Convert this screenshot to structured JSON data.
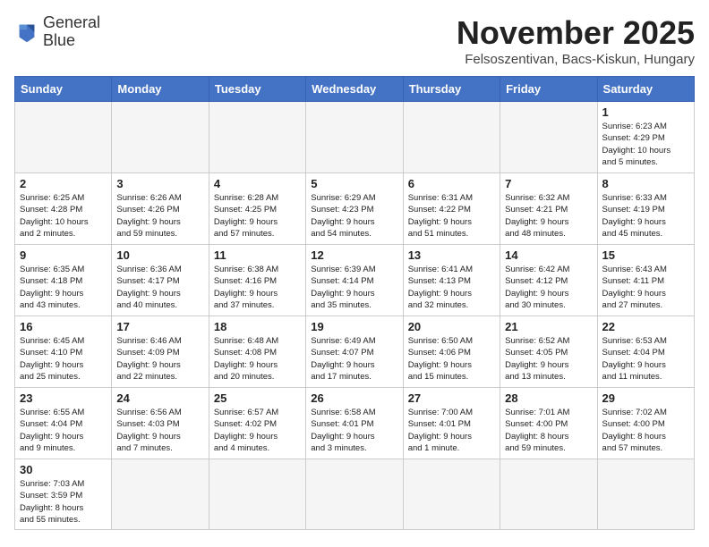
{
  "header": {
    "logo_line1": "General",
    "logo_line2": "Blue",
    "month_title": "November 2025",
    "location": "Felsoszentivan, Bacs-Kiskun, Hungary"
  },
  "weekdays": [
    "Sunday",
    "Monday",
    "Tuesday",
    "Wednesday",
    "Thursday",
    "Friday",
    "Saturday"
  ],
  "weeks": [
    [
      {
        "day": "",
        "info": ""
      },
      {
        "day": "",
        "info": ""
      },
      {
        "day": "",
        "info": ""
      },
      {
        "day": "",
        "info": ""
      },
      {
        "day": "",
        "info": ""
      },
      {
        "day": "",
        "info": ""
      },
      {
        "day": "1",
        "info": "Sunrise: 6:23 AM\nSunset: 4:29 PM\nDaylight: 10 hours\nand 5 minutes."
      }
    ],
    [
      {
        "day": "2",
        "info": "Sunrise: 6:25 AM\nSunset: 4:28 PM\nDaylight: 10 hours\nand 2 minutes."
      },
      {
        "day": "3",
        "info": "Sunrise: 6:26 AM\nSunset: 4:26 PM\nDaylight: 9 hours\nand 59 minutes."
      },
      {
        "day": "4",
        "info": "Sunrise: 6:28 AM\nSunset: 4:25 PM\nDaylight: 9 hours\nand 57 minutes."
      },
      {
        "day": "5",
        "info": "Sunrise: 6:29 AM\nSunset: 4:23 PM\nDaylight: 9 hours\nand 54 minutes."
      },
      {
        "day": "6",
        "info": "Sunrise: 6:31 AM\nSunset: 4:22 PM\nDaylight: 9 hours\nand 51 minutes."
      },
      {
        "day": "7",
        "info": "Sunrise: 6:32 AM\nSunset: 4:21 PM\nDaylight: 9 hours\nand 48 minutes."
      },
      {
        "day": "8",
        "info": "Sunrise: 6:33 AM\nSunset: 4:19 PM\nDaylight: 9 hours\nand 45 minutes."
      }
    ],
    [
      {
        "day": "9",
        "info": "Sunrise: 6:35 AM\nSunset: 4:18 PM\nDaylight: 9 hours\nand 43 minutes."
      },
      {
        "day": "10",
        "info": "Sunrise: 6:36 AM\nSunset: 4:17 PM\nDaylight: 9 hours\nand 40 minutes."
      },
      {
        "day": "11",
        "info": "Sunrise: 6:38 AM\nSunset: 4:16 PM\nDaylight: 9 hours\nand 37 minutes."
      },
      {
        "day": "12",
        "info": "Sunrise: 6:39 AM\nSunset: 4:14 PM\nDaylight: 9 hours\nand 35 minutes."
      },
      {
        "day": "13",
        "info": "Sunrise: 6:41 AM\nSunset: 4:13 PM\nDaylight: 9 hours\nand 32 minutes."
      },
      {
        "day": "14",
        "info": "Sunrise: 6:42 AM\nSunset: 4:12 PM\nDaylight: 9 hours\nand 30 minutes."
      },
      {
        "day": "15",
        "info": "Sunrise: 6:43 AM\nSunset: 4:11 PM\nDaylight: 9 hours\nand 27 minutes."
      }
    ],
    [
      {
        "day": "16",
        "info": "Sunrise: 6:45 AM\nSunset: 4:10 PM\nDaylight: 9 hours\nand 25 minutes."
      },
      {
        "day": "17",
        "info": "Sunrise: 6:46 AM\nSunset: 4:09 PM\nDaylight: 9 hours\nand 22 minutes."
      },
      {
        "day": "18",
        "info": "Sunrise: 6:48 AM\nSunset: 4:08 PM\nDaylight: 9 hours\nand 20 minutes."
      },
      {
        "day": "19",
        "info": "Sunrise: 6:49 AM\nSunset: 4:07 PM\nDaylight: 9 hours\nand 17 minutes."
      },
      {
        "day": "20",
        "info": "Sunrise: 6:50 AM\nSunset: 4:06 PM\nDaylight: 9 hours\nand 15 minutes."
      },
      {
        "day": "21",
        "info": "Sunrise: 6:52 AM\nSunset: 4:05 PM\nDaylight: 9 hours\nand 13 minutes."
      },
      {
        "day": "22",
        "info": "Sunrise: 6:53 AM\nSunset: 4:04 PM\nDaylight: 9 hours\nand 11 minutes."
      }
    ],
    [
      {
        "day": "23",
        "info": "Sunrise: 6:55 AM\nSunset: 4:04 PM\nDaylight: 9 hours\nand 9 minutes."
      },
      {
        "day": "24",
        "info": "Sunrise: 6:56 AM\nSunset: 4:03 PM\nDaylight: 9 hours\nand 7 minutes."
      },
      {
        "day": "25",
        "info": "Sunrise: 6:57 AM\nSunset: 4:02 PM\nDaylight: 9 hours\nand 4 minutes."
      },
      {
        "day": "26",
        "info": "Sunrise: 6:58 AM\nSunset: 4:01 PM\nDaylight: 9 hours\nand 3 minutes."
      },
      {
        "day": "27",
        "info": "Sunrise: 7:00 AM\nSunset: 4:01 PM\nDaylight: 9 hours\nand 1 minute."
      },
      {
        "day": "28",
        "info": "Sunrise: 7:01 AM\nSunset: 4:00 PM\nDaylight: 8 hours\nand 59 minutes."
      },
      {
        "day": "29",
        "info": "Sunrise: 7:02 AM\nSunset: 4:00 PM\nDaylight: 8 hours\nand 57 minutes."
      }
    ],
    [
      {
        "day": "30",
        "info": "Sunrise: 7:03 AM\nSunset: 3:59 PM\nDaylight: 8 hours\nand 55 minutes."
      },
      {
        "day": "",
        "info": ""
      },
      {
        "day": "",
        "info": ""
      },
      {
        "day": "",
        "info": ""
      },
      {
        "day": "",
        "info": ""
      },
      {
        "day": "",
        "info": ""
      },
      {
        "day": "",
        "info": ""
      }
    ]
  ]
}
